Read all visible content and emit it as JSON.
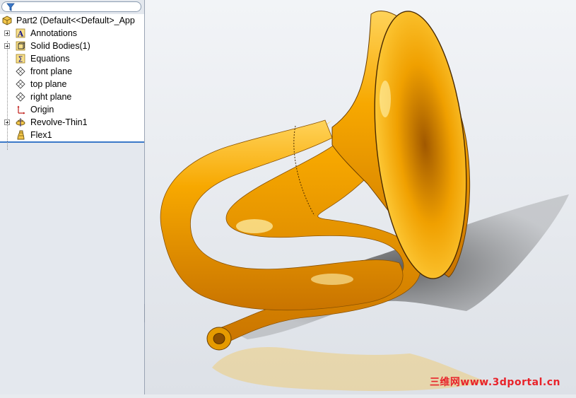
{
  "feature_tree": {
    "filter_icon": "filter-icon",
    "root_label": "Part2  (Default<<Default>_App",
    "items": [
      {
        "label": "Annotations",
        "icon": "annotations-icon",
        "expandable": true
      },
      {
        "label": "Solid Bodies(1)",
        "icon": "solid-bodies-icon",
        "expandable": true
      },
      {
        "label": "Equations",
        "icon": "equations-icon",
        "expandable": false
      },
      {
        "label": "front plane",
        "icon": "plane-icon",
        "expandable": false
      },
      {
        "label": "top plane",
        "icon": "plane-icon",
        "expandable": false
      },
      {
        "label": "right plane",
        "icon": "plane-icon",
        "expandable": false
      },
      {
        "label": "Origin",
        "icon": "origin-icon",
        "expandable": false
      },
      {
        "label": "Revolve-Thin1",
        "icon": "revolve-icon",
        "expandable": true
      },
      {
        "label": "Flex1",
        "icon": "flex-icon",
        "expandable": false
      }
    ]
  },
  "viewport": {
    "model": "horn-model",
    "model_color": "#f7a800",
    "watermark": "三维网www.3dportal.cn",
    "watermark_color": "#e8232a"
  }
}
